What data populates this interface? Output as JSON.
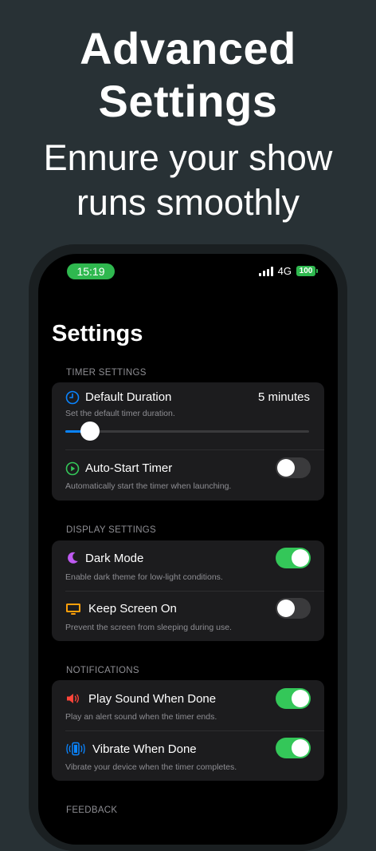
{
  "promo": {
    "title_line1": "Advanced",
    "title_line2": "Settings",
    "subtitle_line1": "Ennure your show",
    "subtitle_line2": "runs smoothly"
  },
  "status_bar": {
    "time": "15:19",
    "network": "4G",
    "battery": "100"
  },
  "page": {
    "title": "Settings"
  },
  "sections": {
    "timer": {
      "label": "TIMER SETTINGS",
      "default_duration": {
        "label": "Default Duration",
        "value": "5 minutes",
        "description": "Set the default timer duration.",
        "slider_fraction": 0.1,
        "icon": "clock-icon"
      },
      "auto_start": {
        "label": "Auto-Start Timer",
        "description": "Automatically start the timer when launching.",
        "enabled": false,
        "icon": "play-circle-icon"
      }
    },
    "display": {
      "label": "DISPLAY SETTINGS",
      "dark_mode": {
        "label": "Dark Mode",
        "description": "Enable dark theme for low-light conditions.",
        "enabled": true,
        "icon": "moon-icon"
      },
      "keep_screen_on": {
        "label": "Keep Screen On",
        "description": "Prevent the screen from sleeping during use.",
        "enabled": false,
        "icon": "display-icon"
      }
    },
    "notifications": {
      "label": "NOTIFICATIONS",
      "play_sound": {
        "label": "Play Sound When Done",
        "description": "Play an alert sound when the timer ends.",
        "enabled": true,
        "icon": "speaker-icon"
      },
      "vibrate": {
        "label": "Vibrate When Done",
        "description": "Vibrate your device when the timer completes.",
        "enabled": true,
        "icon": "vibrate-phone-icon"
      }
    },
    "feedback": {
      "label": "FEEDBACK"
    }
  },
  "colors": {
    "background": "#283135",
    "accent_green": "#34c759",
    "accent_blue": "#0a84ff",
    "card": "#1c1c1e",
    "secondary_text": "#8e8e93",
    "moon": "#bf5af2",
    "display_icon": "#ff9f0a",
    "speaker": "#ff453a"
  }
}
